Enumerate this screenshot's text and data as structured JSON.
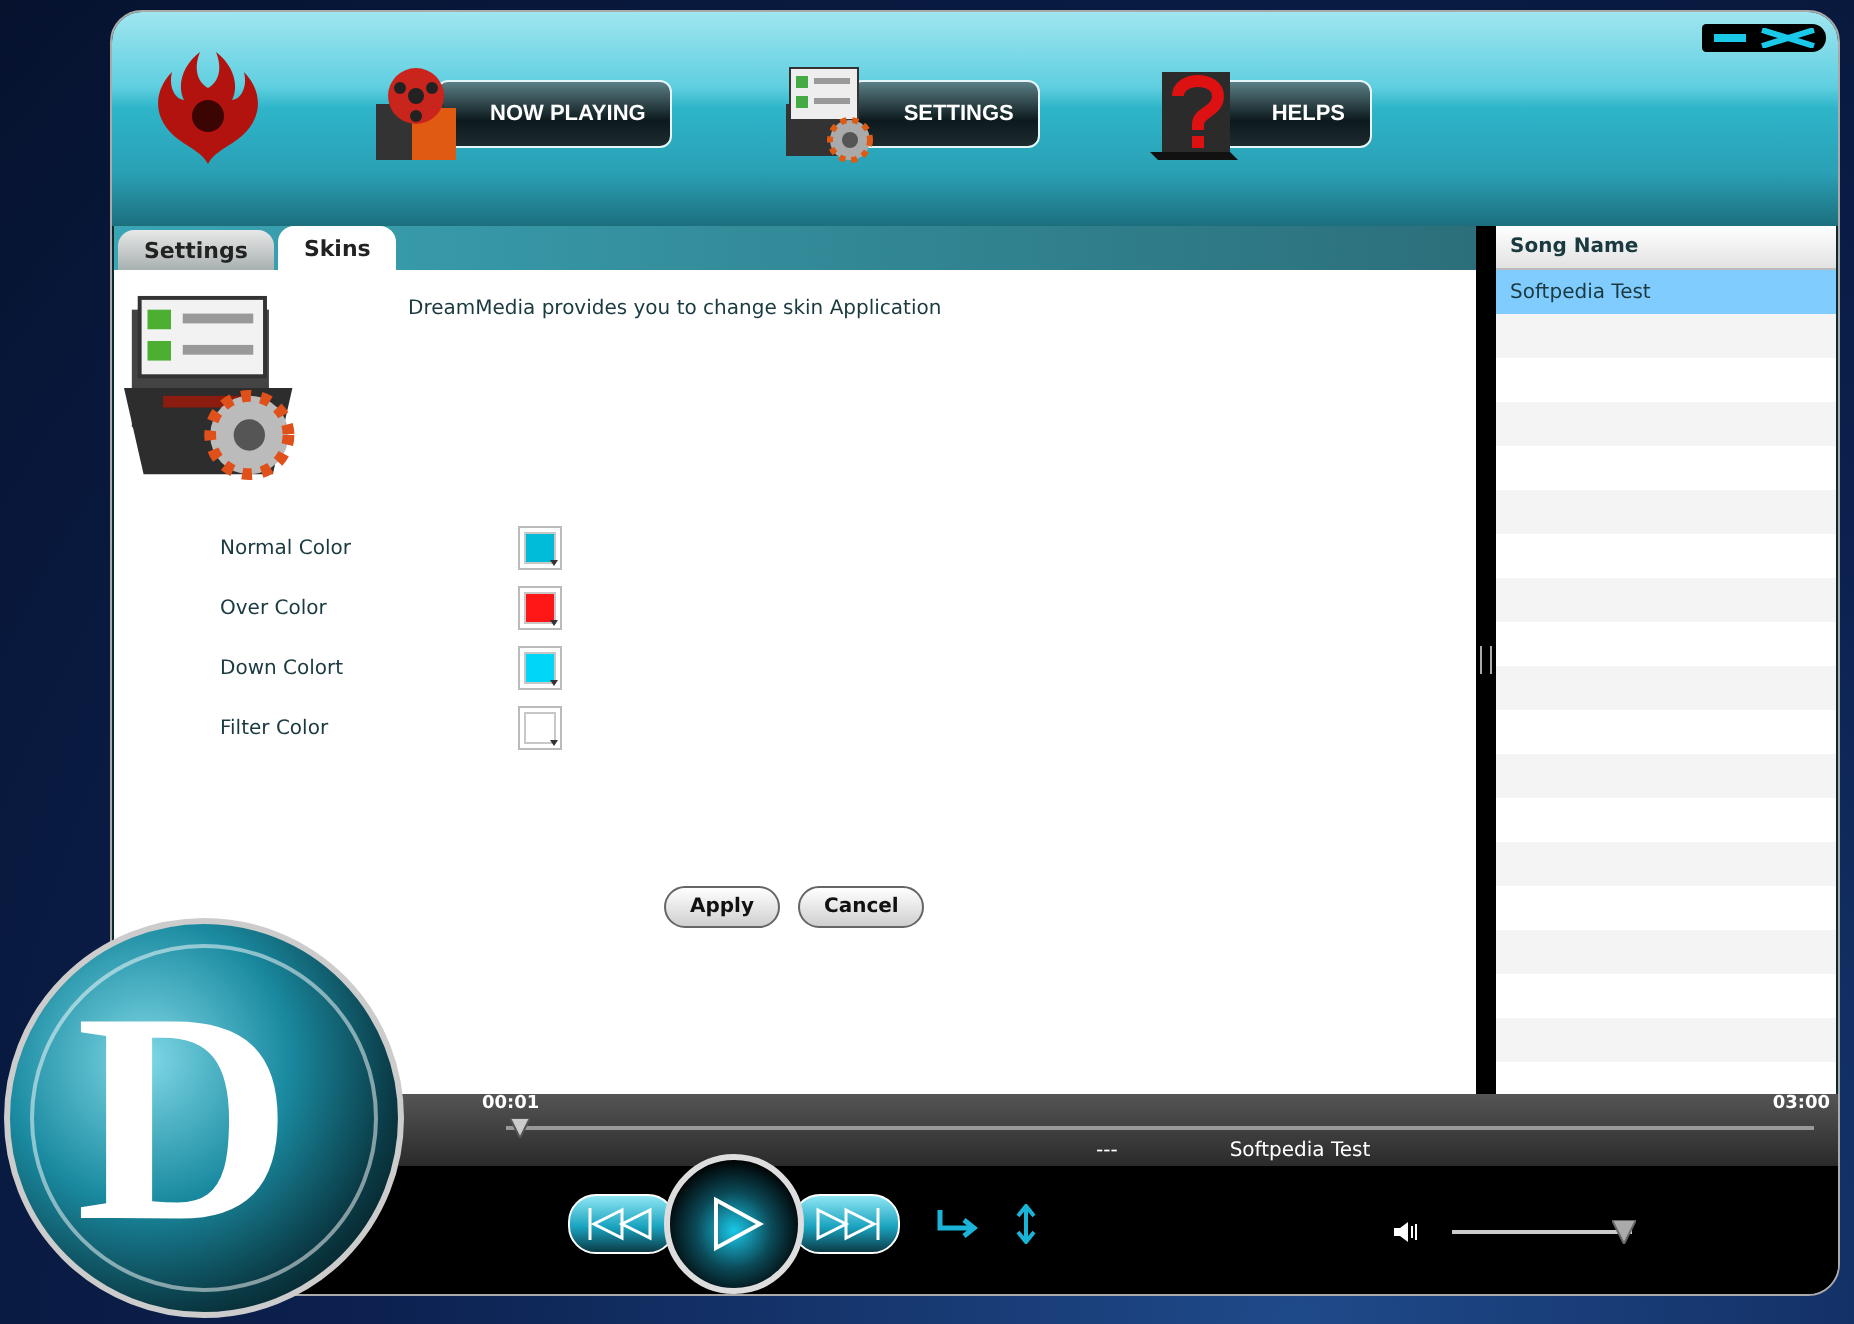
{
  "nav_buttons": [
    {
      "label": "NOW PLAYING",
      "kind": "film"
    },
    {
      "label": "SETTINGS",
      "kind": "gear"
    },
    {
      "label": "HELPS",
      "kind": "help"
    }
  ],
  "tabs": [
    {
      "label": "Settings",
      "selected": false
    },
    {
      "label": "Skins",
      "selected": true
    }
  ],
  "description": "DreamMedia provides you to change skin Application",
  "color_settings": [
    {
      "label": "Normal Color",
      "color": "#00bcd8"
    },
    {
      "label": "Over Color",
      "color": "#ff1717"
    },
    {
      "label": "Down Colort",
      "color": "#00d6f7"
    },
    {
      "label": "Filter Color",
      "color": "#ffffff"
    }
  ],
  "buttons": [
    "Apply",
    "Cancel"
  ],
  "playlist": {
    "column": "Song Name",
    "rows": [
      {
        "name": "Softpedia Test",
        "selected": true
      }
    ]
  },
  "player": {
    "elapsed": "00:01",
    "total": "03:00",
    "level": 0.01,
    "separator": "---",
    "title": "Softpedia Test",
    "volume": {
      "level": 0.95
    }
  },
  "logo_letter": "D"
}
